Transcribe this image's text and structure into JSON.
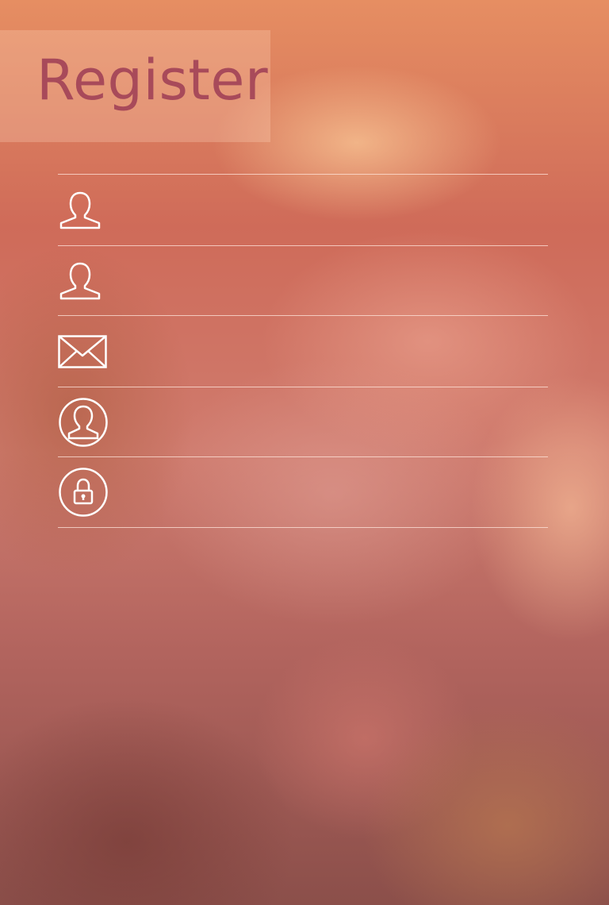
{
  "header": {
    "title": "Register"
  },
  "form": {
    "fields": [
      {
        "icon": "user-outline-icon",
        "value": "",
        "placeholder": ""
      },
      {
        "icon": "user-outline-icon",
        "value": "",
        "placeholder": ""
      },
      {
        "icon": "envelope-icon",
        "value": "",
        "placeholder": ""
      },
      {
        "icon": "user-circle-icon",
        "value": "",
        "placeholder": ""
      },
      {
        "icon": "lock-circle-icon",
        "value": "",
        "placeholder": ""
      }
    ]
  },
  "colors": {
    "title": "#a84a5a",
    "icon_stroke": "#ffffff",
    "divider": "#ffe6dc"
  }
}
